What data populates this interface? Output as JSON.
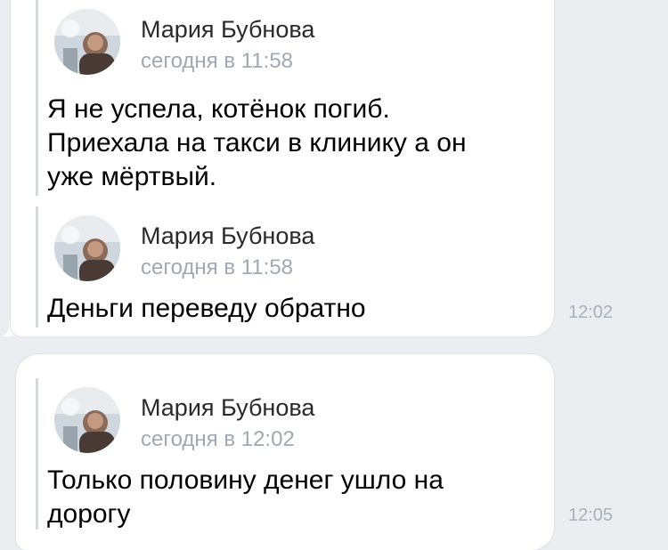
{
  "messages": [
    {
      "forwards": [
        {
          "author": "Мария Бубнова",
          "date": "сегодня в 11:58",
          "text": "Я не успела, котёнок погиб.\nПриехала на такси в клинику а он\nуже мёртвый."
        },
        {
          "author": "Мария Бубнова",
          "date": "сегодня в 11:58",
          "text": "Деньги переведу обратно"
        }
      ],
      "time": "12:02"
    },
    {
      "forwards": [
        {
          "author": "Мария Бубнова",
          "date": "сегодня в 12:02",
          "text": "Только половину денег ушло на\nдорогу"
        }
      ],
      "time": "12:05"
    }
  ],
  "colors": {
    "background": "#ebedf0",
    "bubble": "#ffffff",
    "forward_bar": "#d3d9de",
    "date_text": "#a0a8b3",
    "time_text": "#a8b0ba"
  },
  "icons": {
    "avatar": "user-avatar-photo"
  }
}
